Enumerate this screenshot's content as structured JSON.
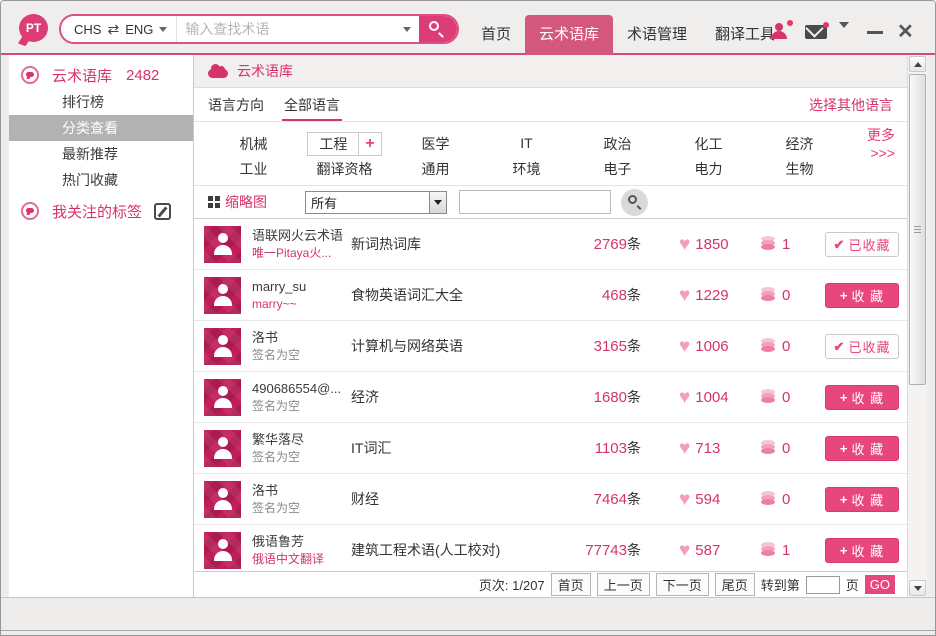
{
  "colors": {
    "accent_pink": "#d6336c",
    "tab_active": "#d4587e",
    "collect_button": "#e8477e",
    "avatar_bg": "#bf1e59",
    "heart": "#f49ebd",
    "titlebar_line": "#d8487c",
    "selected_sidebar_bg": "#b2b2b2"
  },
  "titlebar": {
    "logo": "PT",
    "search": {
      "lang_from": "CHS",
      "swap_icon": "⇄",
      "lang_to": "ENG",
      "placeholder": "输入查找术语"
    },
    "nav": [
      "首页",
      "云术语库",
      "术语管理",
      "翻译工具"
    ],
    "active_tab": "云术语库"
  },
  "sidebar": {
    "section1": {
      "label": "云术语库",
      "count": "2482"
    },
    "items": [
      "排行榜",
      "分类查看",
      "最新推荐",
      "热门收藏"
    ],
    "selected_item": "分类查看",
    "section2": {
      "label": "我关注的标签"
    }
  },
  "content": {
    "breadcrumb": "云术语库",
    "language_row": {
      "label": "语言方向",
      "selected": "全部语言",
      "other_link": "选择其他语言"
    },
    "categories": {
      "row1": [
        "机械",
        "工程",
        "医学",
        "IT",
        "政治",
        "化工",
        "经济"
      ],
      "row2": [
        "工业",
        "翻译资格",
        "通用",
        "环境",
        "电子",
        "电力",
        "生物"
      ],
      "selected": "工程",
      "add_icon": "+",
      "more": "更多>>>"
    },
    "filter": {
      "thumbnail_label": "缩略图",
      "select_value": "所有",
      "search_value": ""
    },
    "rows": [
      {
        "user": "语联网火云术语",
        "sub": "唯一Pitaya火...",
        "sub_pink": true,
        "title": "新词热词库",
        "count": "2769",
        "likes": "1850",
        "stacks": "1",
        "collected": true
      },
      {
        "user": "marry_su",
        "sub": "marry~~",
        "sub_pink": true,
        "title": "食物英语词汇大全",
        "count": "468",
        "likes": "1229",
        "stacks": "0",
        "collected": false
      },
      {
        "user": "洛书",
        "sub": "签名为空",
        "sub_pink": false,
        "title": "计算机与网络英语",
        "count": "3165",
        "likes": "1006",
        "stacks": "0",
        "collected": true
      },
      {
        "user": "490686554@...",
        "sub": "签名为空",
        "sub_pink": false,
        "title": "经济",
        "count": "1680",
        "likes": "1004",
        "stacks": "0",
        "collected": false
      },
      {
        "user": "繁华落尽",
        "sub": "签名为空",
        "sub_pink": false,
        "title": "IT词汇",
        "count": "1103",
        "likes": "713",
        "stacks": "0",
        "collected": false
      },
      {
        "user": "洛书",
        "sub": "签名为空",
        "sub_pink": false,
        "title": "财经",
        "count": "7464",
        "likes": "594",
        "stacks": "0",
        "collected": false
      },
      {
        "user": "俄语鲁芳",
        "sub": "俄语中文翻译",
        "sub_pink": true,
        "title": "建筑工程术语(人工校对)",
        "count": "77743",
        "likes": "587",
        "stacks": "1",
        "collected": false
      }
    ],
    "pagination": {
      "page_info": "页次: 1/207",
      "first": "首页",
      "prev": "上一页",
      "next": "下一页",
      "last": "尾页",
      "goto_prefix": "转到第",
      "goto_value": "",
      "goto_suffix": "页",
      "go": "GO"
    }
  },
  "labels": {
    "count_suffix": "条",
    "collect": "收 藏",
    "collect_icon": "+",
    "collected": "已收藏",
    "collected_icon": "✔"
  }
}
